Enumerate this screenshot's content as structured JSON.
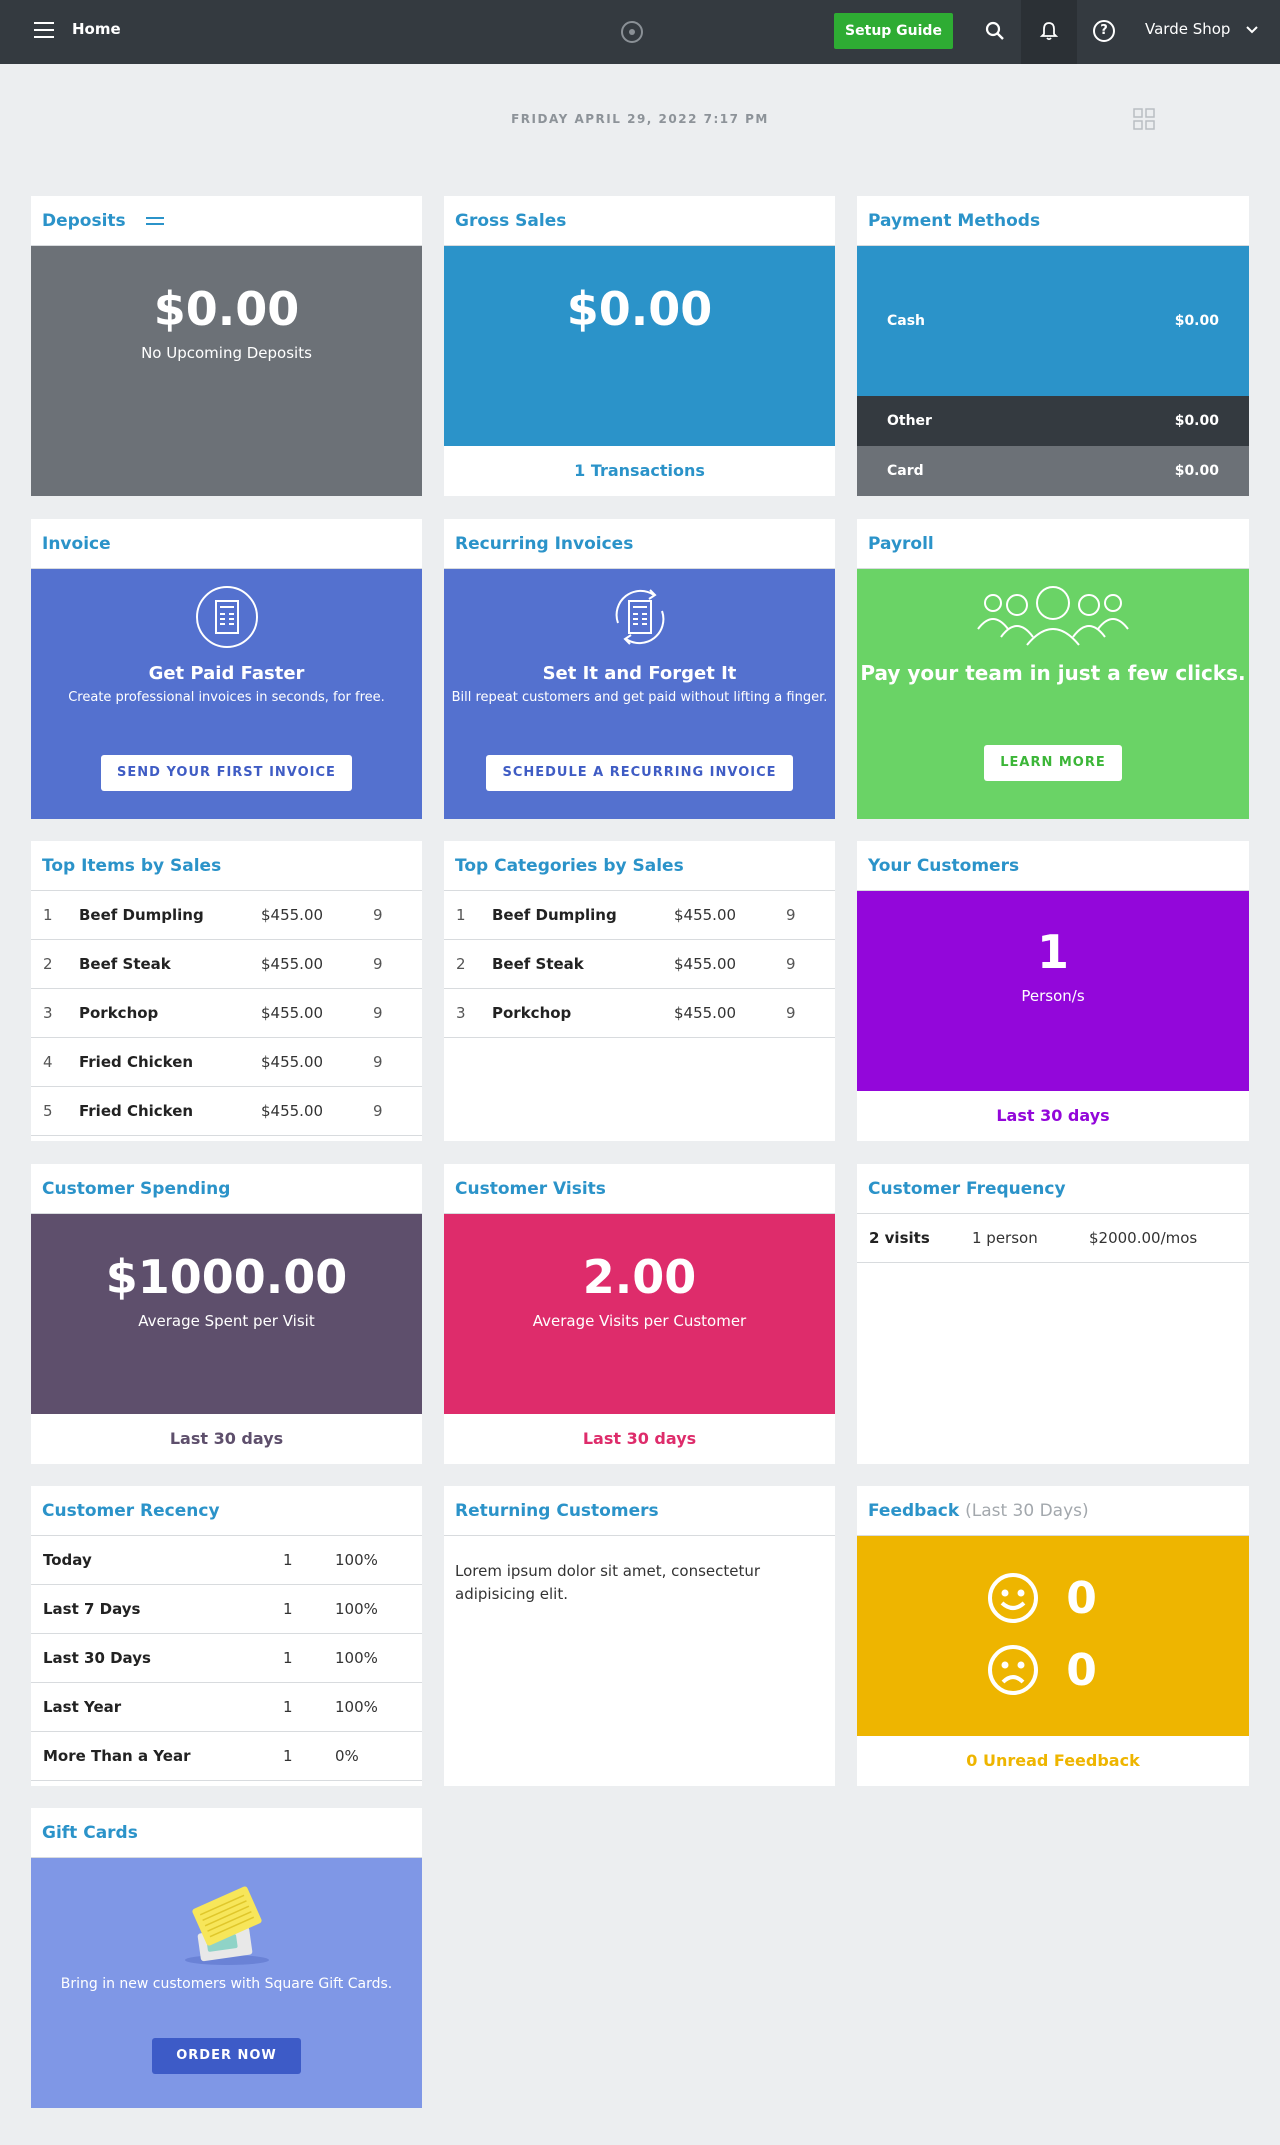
{
  "topbar": {
    "home": "Home",
    "setup_guide": "Setup Guide",
    "shop": "Varde Shop"
  },
  "date": "FRIDAY  APRIL 29, 2022 7:17 PM",
  "deposits": {
    "title": "Deposits",
    "amount": "$0.00",
    "sub": "No Upcoming Deposits",
    "color": "#6c7177"
  },
  "gross_sales": {
    "title": "Gross Sales",
    "amount": "$0.00",
    "link": "1 Transactions",
    "color": "#2b93c9"
  },
  "payment_methods": {
    "title": "Payment Methods",
    "rows": [
      {
        "label": "Cash",
        "value": "$0.00",
        "color": "#2b93c9"
      },
      {
        "label": "Other",
        "value": "$0.00",
        "color": "#343a40"
      },
      {
        "label": "Card",
        "value": "$0.00",
        "color": "#6c7177"
      }
    ]
  },
  "invoice": {
    "title": "Invoice",
    "heading": "Get Paid Faster",
    "sub": "Create professional invoices in seconds, for free.",
    "button": "SEND YOUR FIRST INVOICE",
    "color": "#5471cf"
  },
  "recurring": {
    "title": "Recurring Invoices",
    "heading": "Set It and Forget It",
    "sub": "Bill repeat customers and get paid without lifting a finger.",
    "button": "SCHEDULE A RECURRING INVOICE",
    "color": "#5471cf"
  },
  "payroll": {
    "title": "Payroll",
    "heading": "Pay your team in just a few clicks.",
    "button": "LEARN MORE",
    "color": "#6ad366"
  },
  "top_items": {
    "title": "Top Items by Sales",
    "rows": [
      {
        "rank": "1",
        "name": "Beef Dumpling",
        "amount": "$455.00",
        "qty": "9"
      },
      {
        "rank": "2",
        "name": "Beef Steak",
        "amount": "$455.00",
        "qty": "9"
      },
      {
        "rank": "3",
        "name": "Porkchop",
        "amount": "$455.00",
        "qty": "9"
      },
      {
        "rank": "4",
        "name": "Fried Chicken",
        "amount": "$455.00",
        "qty": "9"
      },
      {
        "rank": "5",
        "name": "Fried Chicken",
        "amount": "$455.00",
        "qty": "9"
      }
    ]
  },
  "top_categories": {
    "title": "Top Categories by Sales",
    "rows": [
      {
        "rank": "1",
        "name": "Beef Dumpling",
        "amount": "$455.00",
        "qty": "9"
      },
      {
        "rank": "2",
        "name": "Beef Steak",
        "amount": "$455.00",
        "qty": "9"
      },
      {
        "rank": "3",
        "name": "Porkchop",
        "amount": "$455.00",
        "qty": "9"
      }
    ]
  },
  "your_customers": {
    "title": "Your Customers",
    "count": "1",
    "sub": "Person/s",
    "link": "Last 30 days",
    "color": "#9307da"
  },
  "customer_spending": {
    "title": "Customer Spending",
    "amount": "$1000.00",
    "sub": "Average Spent per Visit",
    "link": "Last 30 days",
    "color": "#5e4f6c"
  },
  "customer_visits": {
    "title": "Customer Visits",
    "amount": "2.00",
    "sub": "Average Visits per Customer",
    "link": "Last 30 days",
    "color": "#de2c6b"
  },
  "customer_frequency": {
    "title": "Customer Frequency",
    "visits": "2 visits",
    "persons": "1 person",
    "amount": "$2000.00/mos"
  },
  "customer_recency": {
    "title": "Customer Recency",
    "rows": [
      {
        "label": "Today",
        "count": "1",
        "pct": "100%"
      },
      {
        "label": "Last 7 Days",
        "count": "1",
        "pct": "100%"
      },
      {
        "label": "Last 30 Days",
        "count": "1",
        "pct": "100%"
      },
      {
        "label": "Last Year",
        "count": "1",
        "pct": "100%"
      },
      {
        "label": "More Than a Year",
        "count": "1",
        "pct": "0%"
      }
    ]
  },
  "returning_customers": {
    "title": "Returning Customers",
    "text": "Lorem ipsum dolor sit amet, consectetur adipisicing elit."
  },
  "feedback": {
    "title": "Feedback",
    "period": "(Last 30 Days)",
    "happy": "0",
    "sad": "0",
    "link": "0 Unread Feedback",
    "color": "#eeb500"
  },
  "gift_cards": {
    "title": "Gift Cards",
    "sub": "Bring in new customers with Square Gift Cards.",
    "button": "ORDER NOW",
    "color": "#7f97e6"
  }
}
